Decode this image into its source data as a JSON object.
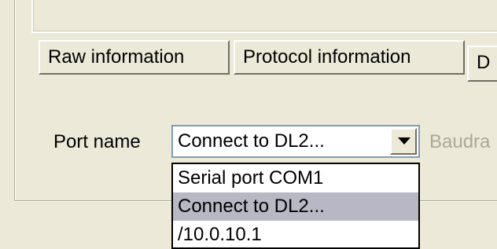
{
  "tabs": [
    {
      "label": "Raw information"
    },
    {
      "label": "Protocol information"
    },
    {
      "label": "D"
    }
  ],
  "port": {
    "label": "Port name",
    "selected_value": "Connect to DL2...",
    "options": [
      "Serial port COM1",
      "Connect to DL2...",
      "/10.0.10.1"
    ]
  },
  "baudrate": {
    "label": "Baudra"
  }
}
